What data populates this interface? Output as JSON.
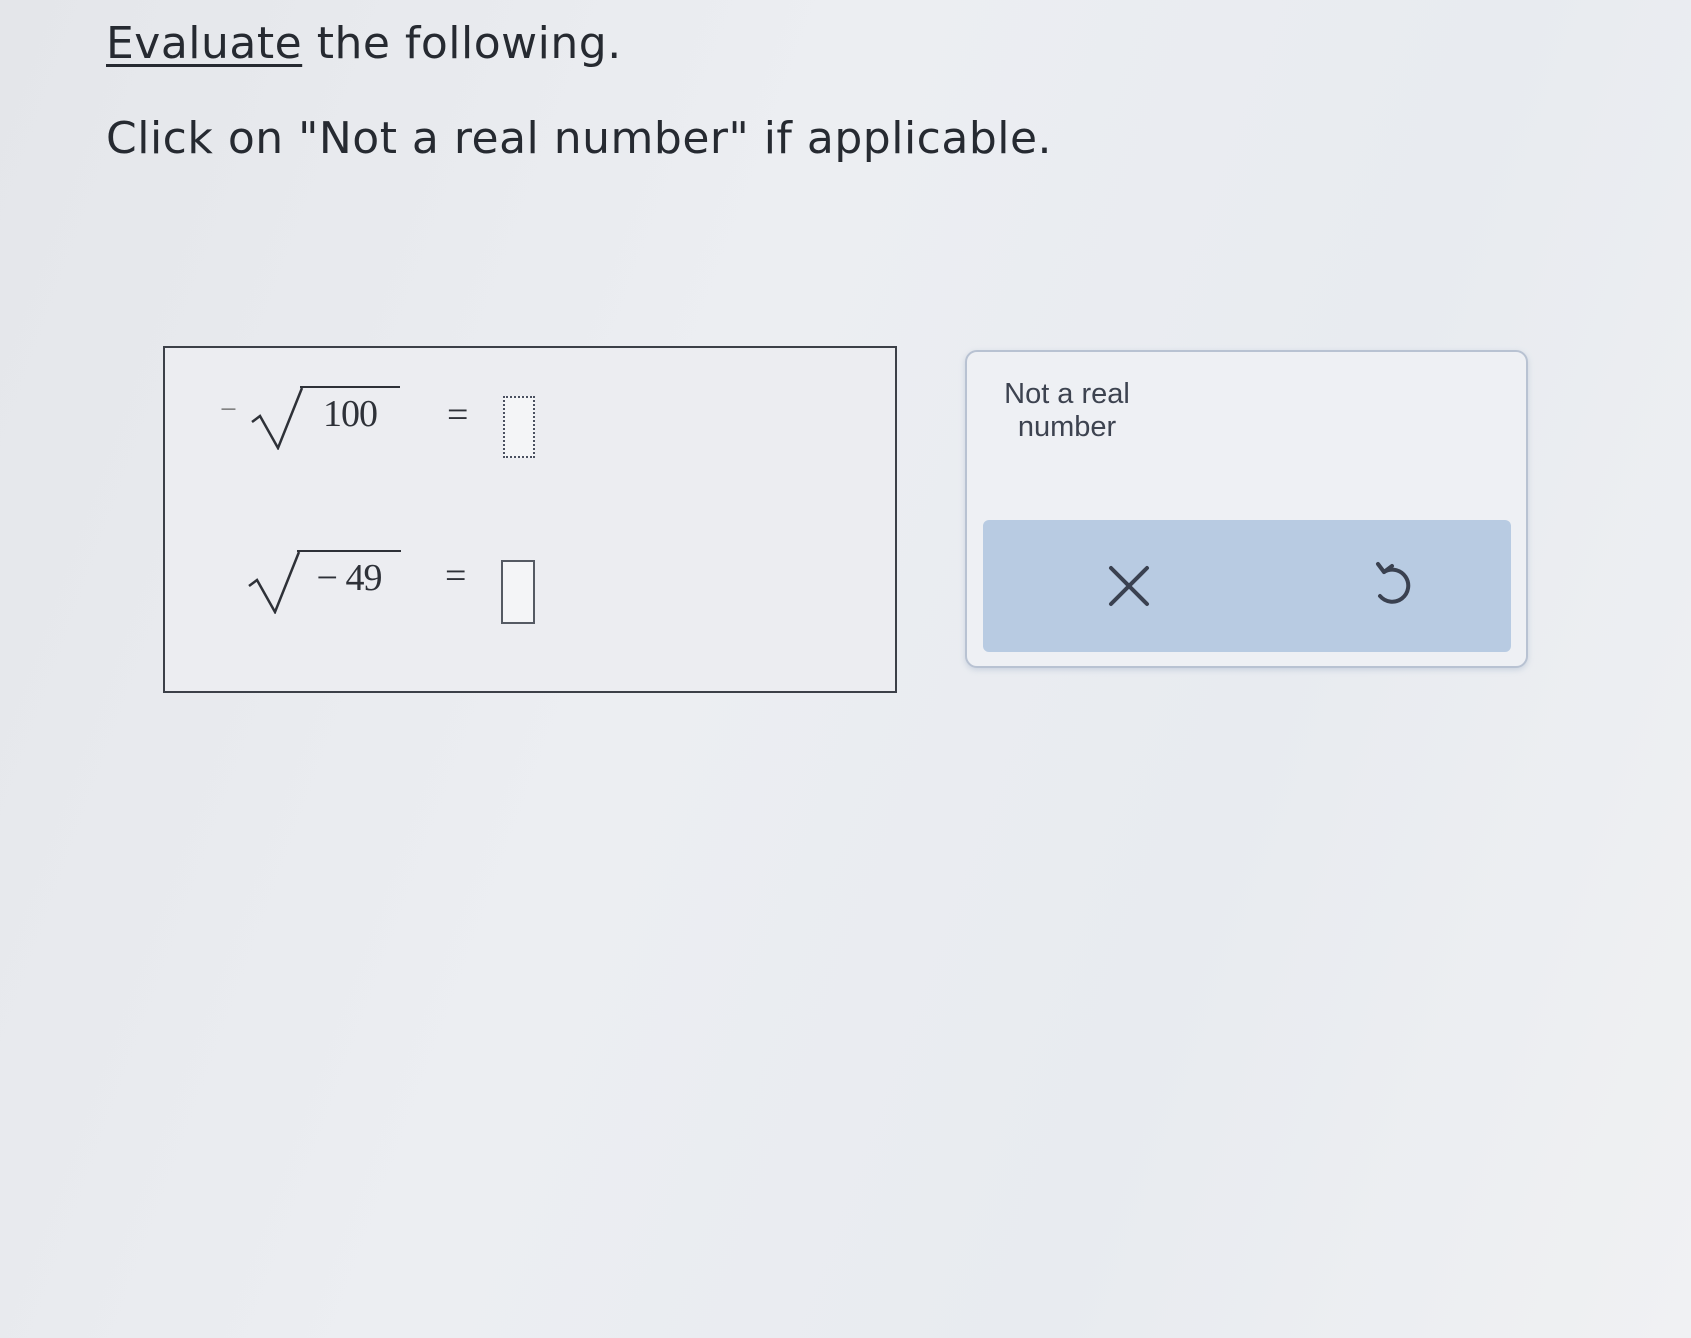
{
  "instructions": {
    "title_link": "Evaluate",
    "title_rest": " the following.",
    "subtitle": "Click on \"Not a real number\" if applicable."
  },
  "problems": [
    {
      "prefix": "−",
      "radicand": "100",
      "equals": "=",
      "answer_value": ""
    },
    {
      "prefix": "",
      "radicand": "− 49",
      "equals": "=",
      "answer_value": ""
    }
  ],
  "tools": {
    "not_real_number_label": "Not a real number",
    "clear_icon": "x-icon",
    "undo_icon": "undo-icon"
  },
  "colors": {
    "action_bar": "#b8cbe2",
    "icon": "#3a4150"
  }
}
